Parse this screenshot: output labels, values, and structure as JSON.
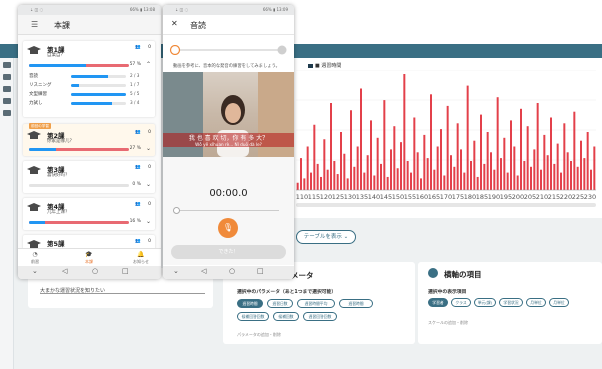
{
  "dashboard": {
    "chart_legend": "■ 週習時間",
    "table_toggle": "テーブルを表示",
    "left_card": {
      "select_value": "大まかな運習状況を知りたい"
    },
    "mid_card": {
      "title": "メータ",
      "subtitle": "選択中のパラメータ（あと1つまで選択可能）",
      "pills": [
        "週習時間",
        "週習日数",
        "週習時間平均",
        "週習時間",
        "候補回答回数",
        "候補回数",
        "週習回答回数"
      ],
      "footer": "パラメータの追加・削除"
    },
    "right_card": {
      "title": "横軸の項目",
      "subtitle": "選択中の表示項目",
      "pills": [
        "学習者",
        "クラス",
        "単元(課)",
        "学習状況",
        "月単位",
        "月単位"
      ],
      "footer": "スケールの追加・削除"
    }
  },
  "chart_data": {
    "type": "bar",
    "title": "",
    "legend": [
      "週習時間"
    ],
    "x_ticks": [
      "110",
      "115",
      "120",
      "125",
      "130",
      "135",
      "140",
      "145",
      "150",
      "155",
      "160",
      "165",
      "170",
      "175",
      "180",
      "185",
      "190",
      "195",
      "200",
      "205",
      "210",
      "215",
      "220",
      "225",
      "230"
    ],
    "values": [
      5,
      22,
      8,
      30,
      12,
      45,
      18,
      9,
      35,
      14,
      60,
      20,
      11,
      40,
      25,
      8,
      55,
      16,
      30,
      70,
      12,
      24,
      48,
      10,
      36,
      18,
      62,
      9,
      28,
      44,
      15,
      33,
      80,
      20,
      12,
      50,
      26,
      8,
      38,
      22,
      66,
      14,
      30,
      42,
      10,
      58,
      24,
      16,
      46,
      28,
      12,
      72,
      20,
      34,
      9,
      52,
      18,
      40,
      26,
      14,
      64,
      22,
      36,
      12,
      48,
      30,
      10,
      56,
      20,
      44,
      16,
      28,
      60,
      14,
      38,
      24,
      50,
      18,
      32,
      12,
      46,
      26,
      20,
      54,
      16,
      34,
      22,
      40,
      14,
      30
    ],
    "series_color": "#e3404a"
  },
  "phone1": {
    "status_left": "⇣ ◫ ◌",
    "status_right": "66% ▮ 13:08",
    "title": "本課",
    "lessons": [
      {
        "name": "第1課",
        "sub": "自業自？",
        "count": "0",
        "pct": "57 %"
      },
      {
        "name": "第2課",
        "sub": "你家是哪儿？",
        "count": "0",
        "pct": "27 %",
        "badge": "前回の学習"
      },
      {
        "name": "第3課",
        "sub": "喜快好吗？",
        "count": "0",
        "pct": "0 %"
      },
      {
        "name": "第4課",
        "sub": "几年上课？",
        "count": "0",
        "pct": "16 %"
      },
      {
        "name": "第5課",
        "sub": "",
        "count": "0",
        "pct": ""
      }
    ],
    "skills": [
      {
        "label": "音読",
        "val": "2 / 3"
      },
      {
        "label": "リスニング",
        "val": "1 / 7"
      },
      {
        "label": "文型練習",
        "val": "5 / 5"
      },
      {
        "label": "力試し",
        "val": "3 / 4"
      }
    ],
    "nav": [
      "前習",
      "本課",
      "お知らせ"
    ],
    "sysnav": [
      "⌄",
      "◁",
      "○",
      "□"
    ]
  },
  "phone2": {
    "status_left": "⇣ ◫ ◌",
    "status_right": "66% ▮ 13:09",
    "title": "音読",
    "instruction": "動画を参考に、音本的な発音の練習をしてみましょう。",
    "sub_cn": "我 也 喜 欢 切，你 有 多 大？",
    "sub_pinyin": "Wǒ yě xǐhuan rè... Nǐ duō dà le?",
    "timer": "00:00.0",
    "done_label": "できた！",
    "sysnav": [
      "⌄",
      "◁",
      "○",
      "□"
    ]
  }
}
